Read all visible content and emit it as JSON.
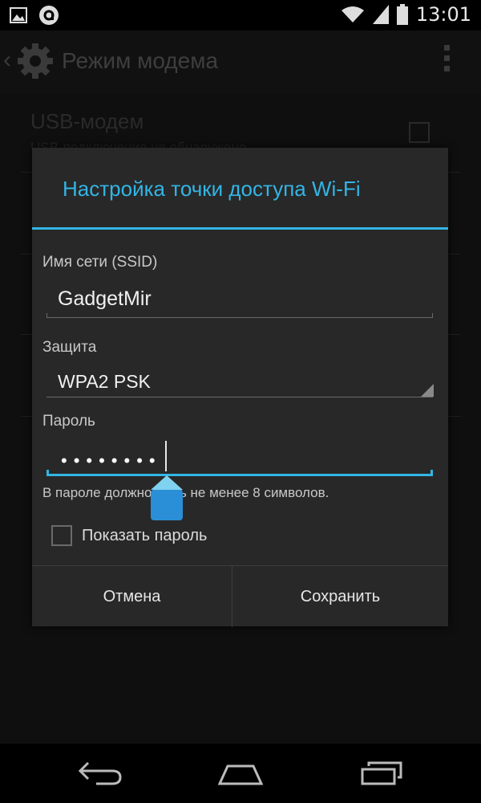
{
  "status_bar": {
    "time": "13:01",
    "icons": [
      "gallery-icon",
      "app-notification-icon",
      "wifi-icon",
      "signal-icon",
      "battery-icon"
    ]
  },
  "action_bar": {
    "title": "Режим модема",
    "icons": [
      "back-caret-icon",
      "settings-gear-icon",
      "overflow-menu-icon"
    ]
  },
  "background": {
    "item_title": "USB-модем",
    "item_subtitle": "USB-подключение не обнаружено"
  },
  "dialog": {
    "title": "Настройка точки доступа Wi-Fi",
    "ssid_label": "Имя сети (SSID)",
    "ssid_value": "GadgetMir",
    "security_label": "Защита",
    "security_value": "WPA2 PSK",
    "password_label": "Пароль",
    "password_value": "••••••••",
    "password_hint": "В пароле должно быть не менее 8 символов.",
    "show_password_label": "Показать пароль",
    "show_password_checked": false,
    "cancel_label": "Отмена",
    "save_label": "Сохранить"
  },
  "colors": {
    "accent": "#33b5e5",
    "dialog_bg": "#282828"
  },
  "nav_bar": {
    "icons": [
      "back-icon",
      "home-icon",
      "recent-apps-icon"
    ]
  }
}
